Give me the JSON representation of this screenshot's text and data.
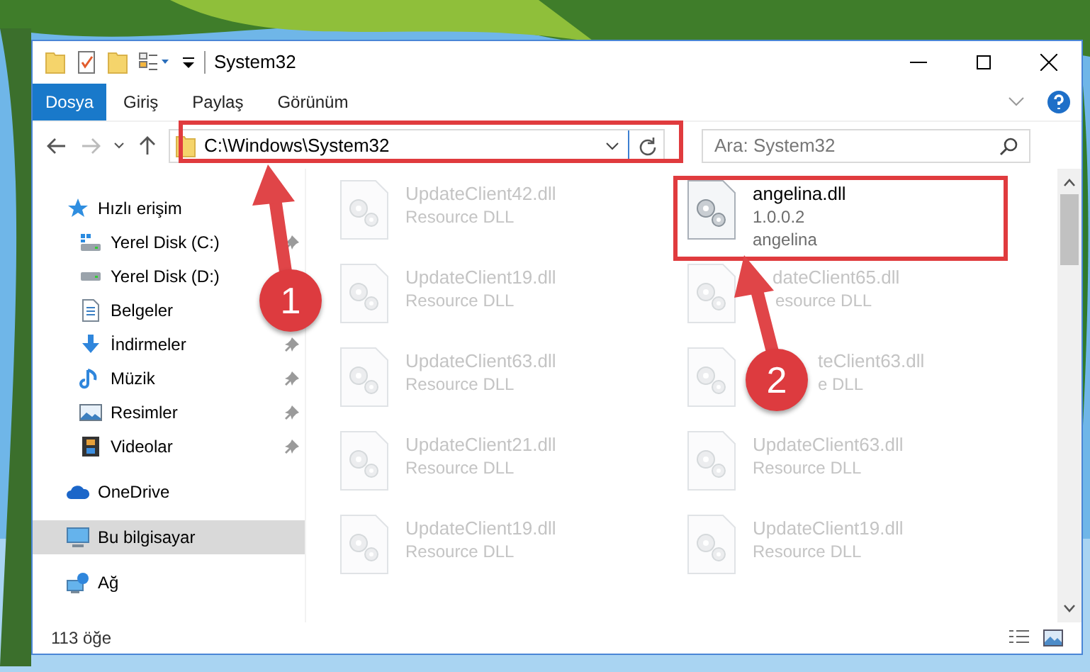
{
  "window": {
    "title": "System32"
  },
  "ribbon_tabs": [
    {
      "label": "Dosya",
      "kind": "file",
      "selected": false
    },
    {
      "label": "Giriş",
      "kind": "tab",
      "selected": false
    },
    {
      "label": "Paylaş",
      "kind": "tab",
      "selected": false
    },
    {
      "label": "Görünüm",
      "kind": "tab",
      "selected": false
    }
  ],
  "address_bar": {
    "path": "C:\\Windows\\System32"
  },
  "search": {
    "placeholder": "Ara: System32"
  },
  "navigation": [
    {
      "label": "Hızlı erişim",
      "kind": "star",
      "selected": false,
      "children": [
        {
          "label": "Yerel Disk (C:)",
          "kind": "system-drive",
          "pinned": true
        },
        {
          "label": "Yerel Disk (D:)",
          "kind": "drive",
          "pinned": false
        },
        {
          "label": "Belgeler",
          "kind": "documents",
          "pinned": false
        },
        {
          "label": "İndirmeler",
          "kind": "downloads",
          "pinned": true
        },
        {
          "label": "Müzik",
          "kind": "music",
          "pinned": true
        },
        {
          "label": "Resimler",
          "kind": "pictures",
          "pinned": true
        },
        {
          "label": "Videolar",
          "kind": "videos",
          "pinned": true
        }
      ]
    },
    {
      "label": "OneDrive",
      "kind": "cloud",
      "selected": false
    },
    {
      "label": "Bu bilgisayar",
      "kind": "computer",
      "selected": true
    },
    {
      "label": "Ağ",
      "kind": "network",
      "selected": false
    }
  ],
  "files": [
    {
      "name": "UpdateClient42.dll",
      "line_2": "Resource DLL",
      "blurred": true
    },
    {
      "name": "angelina.dll",
      "line_2": "1.0.0.2",
      "line_3": "angelina",
      "blurred": false
    },
    {
      "name": "UpdateClient19.dll",
      "line_2": "Resource DLL",
      "blurred": true
    },
    {
      "name": "dateClient65.dll",
      "line_2": "esource DLL",
      "blurred": true
    },
    {
      "name": "UpdateClient63.dll",
      "line_2": "Resource DLL",
      "blurred": true
    },
    {
      "name": "teClient63.dll",
      "line_2": "e DLL",
      "blurred": true
    },
    {
      "name": "UpdateClient21.dll",
      "line_2": "Resource DLL",
      "blurred": true
    },
    {
      "name": "UpdateClient63.dll",
      "line_2": "Resource DLL",
      "blurred": true
    },
    {
      "name": "UpdateClient19.dll",
      "line_2": "Resource DLL",
      "blurred": true
    },
    {
      "name": "UpdateClient19.dll",
      "line_2": "Resource DLL",
      "blurred": true
    }
  ],
  "status_bar": {
    "item_count": "113 öğe"
  },
  "annotations": [
    {
      "number": "1"
    },
    {
      "number": "2"
    }
  ]
}
